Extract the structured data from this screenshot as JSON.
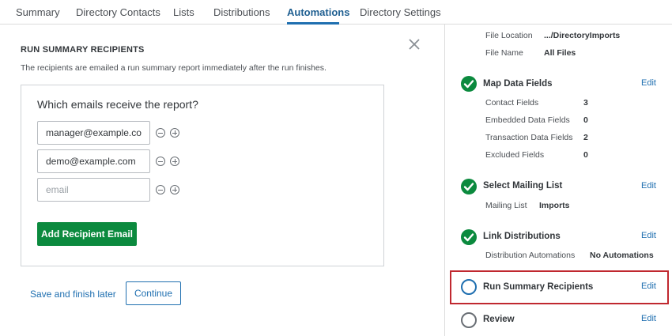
{
  "tabs": [
    {
      "label": "Summary"
    },
    {
      "label": "Directory Contacts"
    },
    {
      "label": "Lists"
    },
    {
      "label": "Distributions"
    },
    {
      "label": "Automations"
    },
    {
      "label": "Directory Settings"
    }
  ],
  "active_tab": "Automations",
  "left": {
    "title": "RUN SUMMARY RECIPIENTS",
    "description": "The recipients are emailed a run summary report immediately after the run finishes.",
    "question": "Which emails receive the report?",
    "emails": [
      {
        "value": "manager@example.com",
        "placeholder": ""
      },
      {
        "value": "demo@example.com",
        "placeholder": ""
      },
      {
        "value": "",
        "placeholder": "email"
      }
    ],
    "add_button": "Add Recipient Email",
    "save_link": "Save and finish later",
    "continue_button": "Continue"
  },
  "right": {
    "file_location_label": "File Location",
    "file_location_value": ".../DirectoryImports",
    "file_name_label": "File Name",
    "file_name_value": "All Files",
    "steps": [
      {
        "title": "Map Data Fields",
        "status": "done",
        "edit": "Edit",
        "details": [
          {
            "label": "Contact Fields",
            "value": "3"
          },
          {
            "label": "Embedded Data Fields",
            "value": "0"
          },
          {
            "label": "Transaction Data Fields",
            "value": "2"
          },
          {
            "label": "Excluded Fields",
            "value": "0"
          }
        ]
      },
      {
        "title": "Select Mailing List",
        "status": "done",
        "edit": "Edit",
        "details": [
          {
            "label": "Mailing List",
            "value": "Imports"
          }
        ]
      },
      {
        "title": "Link Distributions",
        "status": "done",
        "edit": "Edit",
        "details": [
          {
            "label": "Distribution Automations",
            "value": "No Automations"
          }
        ]
      },
      {
        "title": "Run Summary Recipients",
        "status": "current",
        "edit": "Edit",
        "details": []
      },
      {
        "title": "Review",
        "status": "pending",
        "edit": "Edit",
        "details": []
      }
    ]
  },
  "colors": {
    "accent": "#1f6fb0",
    "success": "#0b8a3e",
    "highlight": "#c0282f"
  },
  "icons": {
    "close": "close-icon",
    "remove": "minus-circle-icon",
    "add": "plus-circle-icon",
    "done": "check-circle-icon",
    "pending": "empty-circle-icon"
  }
}
